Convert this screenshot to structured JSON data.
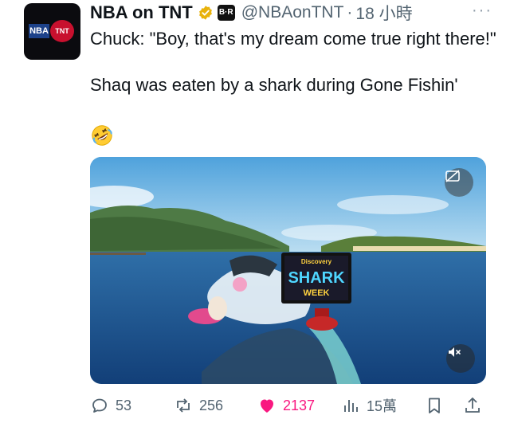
{
  "tweet": {
    "author_name": "NBA on TNT",
    "affiliate_badge": "B·R",
    "handle": "@NBAonTNT",
    "separator": "·",
    "time": "18 小時",
    "more_label": "···",
    "text_line1": "Chuck: \"Boy, that's my dream come true right there!\"",
    "text_line2": "Shaq was eaten by a shark during Gone Fishin'",
    "emoji": "rolling-on-floor-laughing",
    "avatar_logo": {
      "left": "NBA",
      "right": "TNT"
    }
  },
  "media": {
    "billboard_top": "Discovery",
    "billboard_main": "SHARK",
    "billboard_sub": "WEEK"
  },
  "actions": {
    "replies": "53",
    "reposts": "256",
    "likes": "2137",
    "views": "15萬"
  },
  "colors": {
    "like": "#f91880",
    "verified": "#e8b20b",
    "muted_text": "#536471"
  }
}
